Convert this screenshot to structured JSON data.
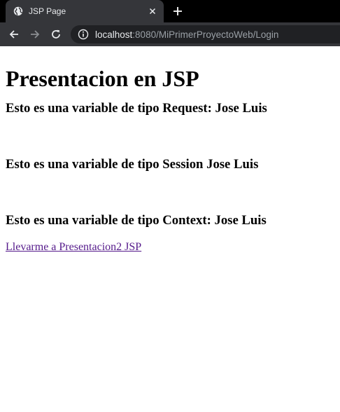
{
  "browser": {
    "tab_title": "JSP Page",
    "url_host": "localhost",
    "url_rest": ":8080/MiPrimerProyectoWeb/Login"
  },
  "content": {
    "heading": "Presentacion en JSP",
    "request_line": "Esto es una variable de tipo Request: Jose Luis",
    "session_line": "Esto es una variable de tipo Session Jose Luis",
    "context_line": "Esto es una variable de tipo Context: Jose Luis",
    "link_text": "Llevarme a Presentacion2 JSP"
  },
  "icons": {
    "favicon": "globe-icon",
    "tab_close": "close-icon",
    "new_tab": "plus-icon",
    "back": "arrow-left-icon",
    "forward": "arrow-right-icon",
    "reload": "reload-icon",
    "site_info": "info-icon"
  },
  "colors": {
    "visited_link": "#551a8b",
    "chrome_dark": "#35363a"
  }
}
